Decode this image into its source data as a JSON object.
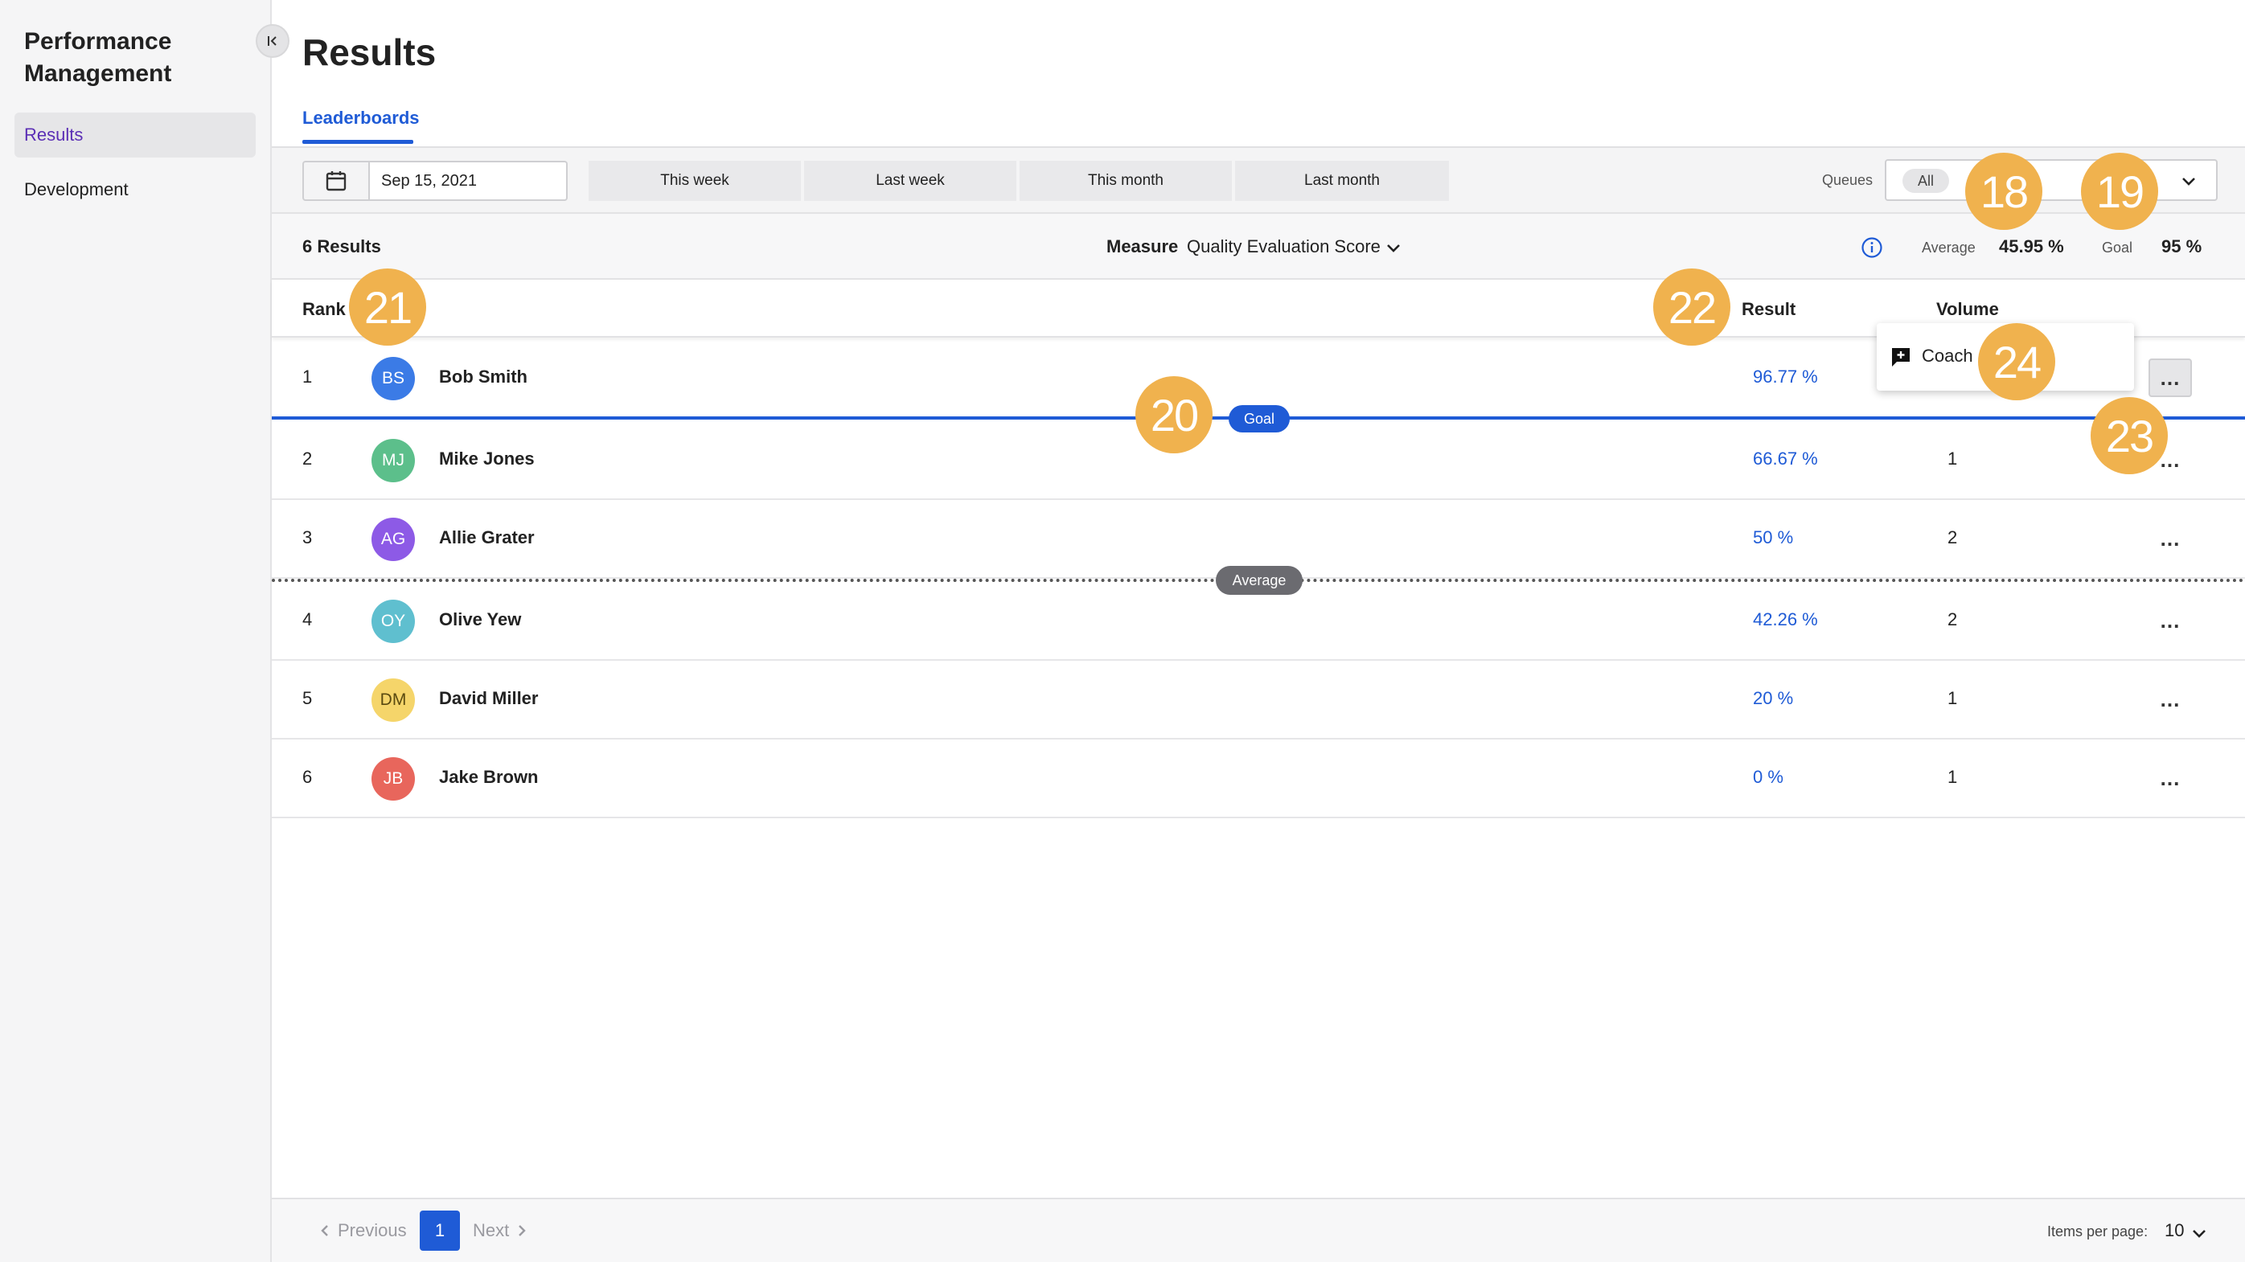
{
  "sidebar": {
    "app_title": "Performance Management",
    "items": [
      {
        "label": "Results",
        "active": true
      },
      {
        "label": "Development",
        "active": false
      }
    ]
  },
  "page": {
    "title": "Results",
    "tab": "Leaderboards"
  },
  "toolbar": {
    "date": "Sep 15, 2021",
    "ranges": [
      "This week",
      "Last week",
      "This month",
      "Last month"
    ],
    "queues_label": "Queues",
    "queues_chip": "All"
  },
  "stats": {
    "results_count": "6 Results",
    "measure_label": "Measure",
    "measure_value": "Quality Evaluation Score",
    "average_label": "Average",
    "average_value": "45.95 %",
    "goal_label": "Goal",
    "goal_value": "95 %"
  },
  "table": {
    "headers": {
      "rank": "Rank",
      "result": "Result",
      "volume": "Volume"
    },
    "rows": [
      {
        "rank": "1",
        "initials": "BS",
        "name": "Bob Smith",
        "result": "96.77 %",
        "volume": "",
        "color": "#3b7be6"
      },
      {
        "rank": "2",
        "initials": "MJ",
        "name": "Mike Jones",
        "result": "66.67 %",
        "volume": "1",
        "color": "#5cbf8b"
      },
      {
        "rank": "3",
        "initials": "AG",
        "name": "Allie Grater",
        "result": "50 %",
        "volume": "2",
        "color": "#8d5ae6"
      },
      {
        "rank": "4",
        "initials": "OY",
        "name": "Olive Yew",
        "result": "42.26 %",
        "volume": "2",
        "color": "#5fbfcf"
      },
      {
        "rank": "5",
        "initials": "DM",
        "name": "David Miller",
        "result": "20 %",
        "volume": "1",
        "color": "#f5d56a"
      },
      {
        "rank": "6",
        "initials": "JB",
        "name": "Jake Brown",
        "result": "0 %",
        "volume": "1",
        "color": "#e8665c"
      }
    ],
    "more_label": "...",
    "goal_marker": "Goal",
    "average_marker": "Average"
  },
  "popover": {
    "coach_label": "Coach"
  },
  "pagination": {
    "previous": "Previous",
    "page": "1",
    "next": "Next",
    "items_per_page_label": "Items per page:",
    "items_per_page_value": "10"
  },
  "callouts": [
    "18",
    "19",
    "20",
    "21",
    "22",
    "23",
    "24"
  ],
  "colors": {
    "accent": "#1f5bd6",
    "callout": "#f0b24e",
    "sidebar_active": "#5b2fb5"
  }
}
